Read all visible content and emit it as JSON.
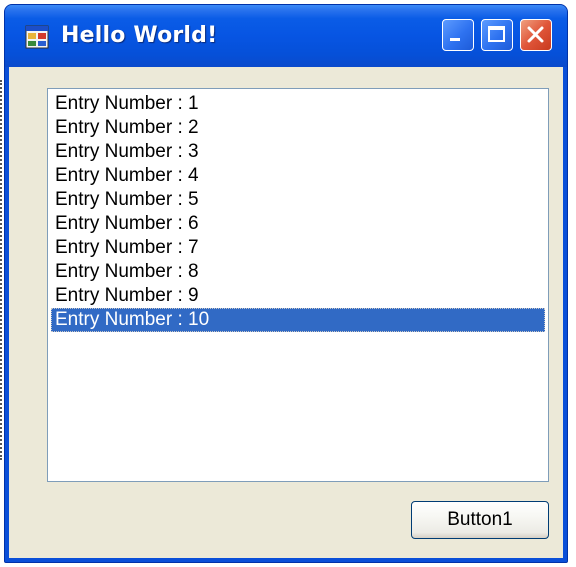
{
  "window": {
    "title": "Hello World!",
    "icon": "app-window-icon",
    "controls": {
      "minimize": "minimize-icon",
      "maximize": "maximize-icon",
      "close": "close-icon"
    }
  },
  "listbox": {
    "items": [
      {
        "label": "Entry Number : 1",
        "selected": false
      },
      {
        "label": "Entry Number : 2",
        "selected": false
      },
      {
        "label": "Entry Number : 3",
        "selected": false
      },
      {
        "label": "Entry Number : 4",
        "selected": false
      },
      {
        "label": "Entry Number : 5",
        "selected": false
      },
      {
        "label": "Entry Number : 6",
        "selected": false
      },
      {
        "label": "Entry Number : 7",
        "selected": false
      },
      {
        "label": "Entry Number : 8",
        "selected": false
      },
      {
        "label": "Entry Number : 9",
        "selected": false
      },
      {
        "label": "Entry Number : 10",
        "selected": true
      }
    ]
  },
  "button1": {
    "label": "Button1"
  },
  "colors": {
    "titlebar": "#0755e3",
    "selection": "#316ac5",
    "client_background": "#ece9d8",
    "close_button": "#e0563a"
  }
}
